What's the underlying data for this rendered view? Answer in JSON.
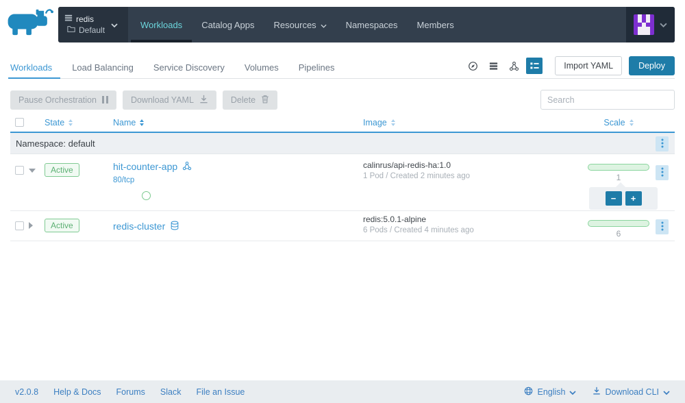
{
  "colors": {
    "navbar_bg": "#333f4d",
    "primary_blue": "#3c97d3",
    "action_blue": "#1e7ca8",
    "badge_green": "#5baf72",
    "avatar_purple": "#7d2fd0"
  },
  "icons": {
    "logo": "rancher-cow-logo",
    "cluster": "stack-icon",
    "project": "folder-icon",
    "views": [
      "compass-view-icon",
      "rows-view-icon",
      "hierarchy-view-icon",
      "grouped-view-icon"
    ],
    "bulk": [
      "pause-icon",
      "download-icon",
      "trash-icon"
    ],
    "row_menu": "dots-vertical-icon",
    "workload": "hierarchy-icon",
    "redis": "database-icon",
    "footer": [
      "globe-icon",
      "download-icon",
      "chevron-down-icon"
    ]
  },
  "header": {
    "cluster_name": "redis",
    "project_name": "Default",
    "nav": [
      {
        "label": "Workloads",
        "active": true
      },
      {
        "label": "Catalog Apps"
      },
      {
        "label": "Resources",
        "caret": true
      },
      {
        "label": "Namespaces"
      },
      {
        "label": "Members"
      }
    ],
    "avatar": {
      "pattern": [
        "10101",
        "10101",
        "11011",
        "10001",
        "10001"
      ],
      "color": "#7d2fd0",
      "bg": "#f2eef6"
    }
  },
  "tabs": {
    "items": [
      {
        "label": "Workloads",
        "active": true
      },
      {
        "label": "Load Balancing"
      },
      {
        "label": "Service Discovery"
      },
      {
        "label": "Volumes"
      },
      {
        "label": "Pipelines"
      }
    ],
    "import_yaml": "Import YAML",
    "deploy": "Deploy"
  },
  "actions": {
    "pause": "Pause Orchestration",
    "download": "Download YAML",
    "delete": "Delete",
    "search_placeholder": "Search"
  },
  "table": {
    "columns": {
      "state": "State",
      "name": "Name",
      "image": "Image",
      "scale": "Scale"
    },
    "group": "Namespace: default",
    "rows": [
      {
        "state": "Active",
        "name": "hit-counter-app",
        "port": "80/tcp",
        "image": "calinrus/api-redis-ha:1.0",
        "meta": "1 Pod / Created 2 minutes ago",
        "scale": "1",
        "minus": "−",
        "plus": "+"
      },
      {
        "state": "Active",
        "name": "redis-cluster",
        "image": "redis:5.0.1-alpine",
        "meta": "6 Pods / Created 4 minutes ago",
        "scale": "6"
      }
    ]
  },
  "footer": {
    "version": "v2.0.8",
    "links": [
      "Help & Docs",
      "Forums",
      "Slack",
      "File an Issue"
    ],
    "language": "English",
    "download_cli": "Download CLI"
  }
}
